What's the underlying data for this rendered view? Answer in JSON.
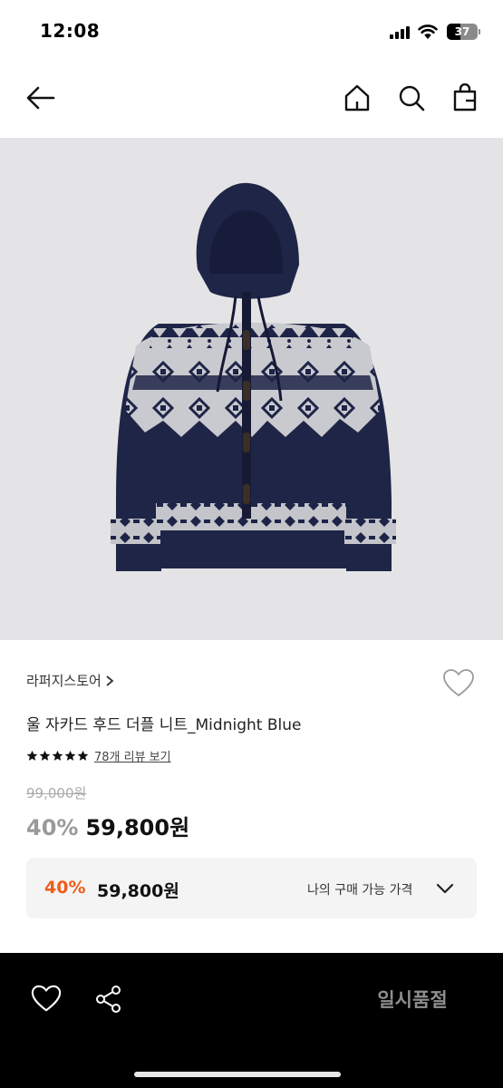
{
  "status_bar": {
    "time": "12:08",
    "battery": "37"
  },
  "nav": {
    "back_icon": "arrow-left-icon",
    "home_icon": "home-icon",
    "search_icon": "search-icon",
    "bag_icon": "shopping-bag-icon"
  },
  "product": {
    "image_alt": "navy nordic pattern wool hooded duffle knit cardigan",
    "brand": "라퍼지스토어",
    "title": "울 자카드 후드 더플 니트_Midnight Blue",
    "rating_stars": 5,
    "review_link": "78개 리뷰 보기",
    "original_price": "99,000원",
    "discount": "40%",
    "sale_price": "59,800원"
  },
  "price_box": {
    "discount": "40%",
    "price": "59,800원",
    "label": "나의 구매 가능 가격"
  },
  "bottom_bar": {
    "like_icon": "heart-icon",
    "share_icon": "share-icon",
    "soldout_label": "일시품절"
  },
  "colors": {
    "accent_discount": "#ef5c1b",
    "image_background": "#e4e4e6",
    "bottom_bar": "#000000"
  }
}
